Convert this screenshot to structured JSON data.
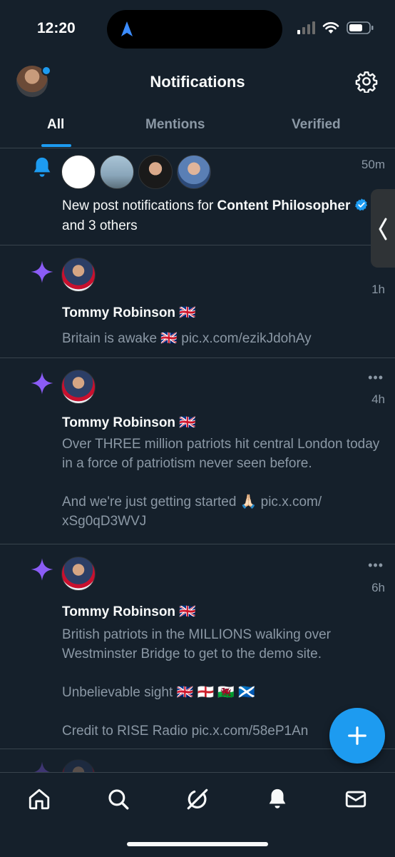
{
  "status_bar": {
    "time": "12:20"
  },
  "header": {
    "title": "Notifications"
  },
  "tabs": [
    {
      "label": "All",
      "active": true
    },
    {
      "label": "Mentions",
      "active": false
    },
    {
      "label": "Verified",
      "active": false
    }
  ],
  "notifications": [
    {
      "type": "bell",
      "time": "50m",
      "text_prefix": "New post notifications for ",
      "text_bold": "Content Philosopher",
      "text_suffix": " and 3 others"
    },
    {
      "type": "star",
      "time": "1h",
      "name": "Tommy Robinson 🇬🇧",
      "body": "Britain is awake 🇬🇧 pic.x.com/ezikJdohAy"
    },
    {
      "type": "star",
      "time": "4h",
      "name": "Tommy Robinson 🇬🇧",
      "body": "Over THREE million patriots hit central London today in a force of patriotism never seen before.\n\nAnd we're just getting started 🙏🏻 pic.x.com/\nxSg0qD3WVJ"
    },
    {
      "type": "star",
      "time": "6h",
      "name": "Tommy Robinson 🇬🇧",
      "body": "British patriots in the MILLIONS walking over Westminster Bridge to get to the demo site.\n\nUnbelievable sight 🇬🇧 🏴󠁧󠁢󠁥󠁮󠁧󠁿 🏴󠁧󠁢󠁷󠁬󠁳󠁿 🏴󠁧󠁢󠁳󠁣󠁴󠁿\n\nCredit to RISE Radio pic.x.com/58eP1An"
    }
  ],
  "colors": {
    "background": "#15202b",
    "accent": "#1d9bf0",
    "star": "#8b5cf6",
    "muted_text": "#8b98a5",
    "divider": "#38444d"
  },
  "icons": {
    "header": [
      "avatar",
      "gear-icon"
    ],
    "nav": [
      "home-icon",
      "search-icon",
      "grok-icon",
      "bell-icon",
      "mail-icon"
    ],
    "fab": "plus-icon"
  }
}
